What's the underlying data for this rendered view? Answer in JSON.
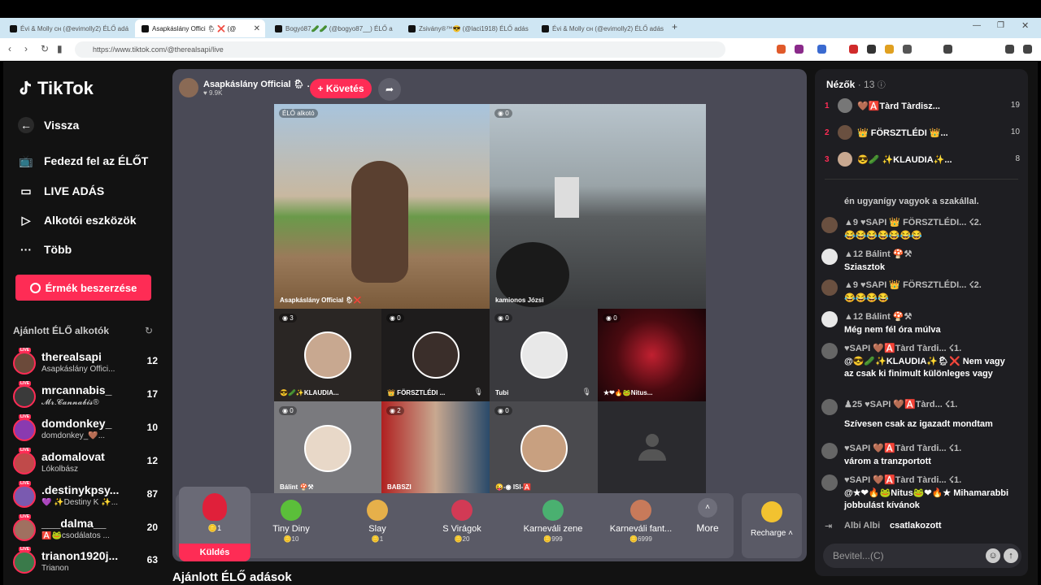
{
  "browser": {
    "tabs": [
      {
        "label": "Évi & Molly cн (@evimolly2) ÉLŐ adá"
      },
      {
        "label": "Asapkáslány Offici 🌦 ❌ (@"
      },
      {
        "label": "Bogyó87🥒🥒 (@bogyo87__) ÉLŐ a"
      },
      {
        "label": "Zsivány®™😎 (@laci1918) ÉLŐ adás"
      },
      {
        "label": "Évi & Molly cн (@evimolly2) ÉLŐ adás"
      }
    ],
    "url": "https://www.tiktok.com/@therealsapi/live"
  },
  "sidebar": {
    "logo": "TikTok",
    "back": "Vissza",
    "nav": [
      {
        "label": "Fedezd fel az ÉLŐT",
        "icon": "tv-icon"
      },
      {
        "label": "LIVE ADÁS",
        "icon": "camera-icon"
      },
      {
        "label": "Alkotói eszközök",
        "icon": "play-box-icon"
      },
      {
        "label": "Több",
        "icon": "more-icon"
      }
    ],
    "coins_button": "Érmék beszerzése",
    "recommended_title": "Ajánlott ÉLŐ alkotók",
    "live_badge": "LIVE",
    "creators": [
      {
        "name": "therealsapi",
        "sub": "Asapkáslány Offici...",
        "count": "12"
      },
      {
        "name": "mrcannabis_",
        "sub": "𝓜𝓻.𝓒𝓪𝓷𝓷𝓪𝓫𝓲𝓼®",
        "count": "17"
      },
      {
        "name": "domdonkey_",
        "sub": "domdonkey_🤎...",
        "count": "10"
      },
      {
        "name": "adomalovat",
        "sub": "Lókolbász",
        "count": "12"
      },
      {
        "name": ".destinykpsy...",
        "sub": "💜 ✨Destiny K ✨...",
        "count": "87"
      },
      {
        "name": "___dalma__",
        "sub": "🅰️🐸csodálatos ...",
        "count": "20"
      },
      {
        "name": "trianon1920j...",
        "sub": "Trianon",
        "count": "63"
      }
    ]
  },
  "stage": {
    "host_name": "Asapkáslány Official 🌦 ...",
    "host_likes": "♥ 9.9K",
    "follow_label": "+ Követés",
    "cells": [
      {
        "badge": "ÉLŐ alkotó",
        "caption": "Asapkáslány Official 🌦❌"
      },
      {
        "badge": "◉ 0",
        "caption": "kamionos Józsi"
      },
      {
        "badge": "◉ 3",
        "caption": "😎🥒✨KLAUDIA..."
      },
      {
        "badge": "◉ 0",
        "caption": "👑 FÖRSZTLÉDI ..."
      },
      {
        "badge": "◉ 0",
        "caption": "Tubi"
      },
      {
        "badge": "◉ 0",
        "caption": "★❤🔥🐸Nitus..."
      },
      {
        "badge": "◉ 0",
        "caption": "Bálint 🍄⚒"
      },
      {
        "badge": "◉ 2",
        "caption": "BABSZI"
      },
      {
        "badge": "◉ 0",
        "caption": "😜-◉ ISI-🅰️"
      },
      {
        "badge": "",
        "caption": ""
      }
    ],
    "gifts": [
      {
        "name": "",
        "price": "1",
        "color": "#e0203a"
      },
      {
        "name": "Tiny Diny",
        "price": "10",
        "color": "#5bbf3a"
      },
      {
        "name": "Slay",
        "price": "1",
        "color": "#e6b04a"
      },
      {
        "name": "S Virágok",
        "price": "20",
        "color": "#d23a55"
      },
      {
        "name": "Karneváli zene",
        "price": "999",
        "color": "#4ab070"
      },
      {
        "name": "Karneváli fant...",
        "price": "6999",
        "color": "#c87a5a"
      }
    ],
    "send_label": "Küldés",
    "more_label": "More",
    "recharge_label": "Recharge ˄",
    "lower_title": "Ajánlott ÉLŐ adások"
  },
  "chat": {
    "viewers_title": "Nézők",
    "viewers_count": "· 13",
    "top_viewers": [
      {
        "rank": "1",
        "name": "🤎🅰️Tàrd Tàrdisz...",
        "score": "19"
      },
      {
        "rank": "2",
        "name": "👑 FÖRSZTLÉDI 👑...",
        "score": "10"
      },
      {
        "rank": "3",
        "name": "😎🥒 ✨KLAUDIA✨...",
        "score": "8"
      }
    ],
    "messages": [
      {
        "header": "",
        "text": "én ugyanígy vagyok a szakállal."
      },
      {
        "header": "▲9 ♥SAPI 👑 FÖRSZTLÉDI... ☇2.",
        "text": "😂😂😂😂😂😂😂"
      },
      {
        "header": "▲12 Bálint 🍄⚒",
        "text": "Sziasztok"
      },
      {
        "header": "▲9 ♥SAPI 👑 FÖRSZTLÉDI... ☇2.",
        "text": "😂😂😂😂"
      },
      {
        "header": "▲12 Bálint 🍄⚒",
        "text": "Még nem fél óra múlva"
      },
      {
        "header": "♥SAPI 🤎🅰️Tàrd Tàrdi... ☇1.",
        "text": "@😎🥒✨KLAUDIA✨🌦❌ Nem vagy az csak ki finimult különleges vagy"
      },
      {
        "header": "♟25 ♥SAPI 🤎🅰️Tàrd... ☇1.",
        "text": "Szívesen csak az igazadt mondtam"
      },
      {
        "header": "♥SAPI 🤎🅰️Tàrd Tàrdi... ☇1.",
        "text": "várom a tranzportott"
      },
      {
        "header": "♥SAPI 🤎🅰️Tàrd Tàrdi... ☇1.",
        "text": "@★❤🔥🐸Nitus🐸❤🔥★ Mihamarabbi jobbulást kívánok"
      },
      {
        "header": "Albi Albi",
        "text": "csatlakozott"
      }
    ],
    "input_placeholder": "Bevitel...(C)"
  }
}
